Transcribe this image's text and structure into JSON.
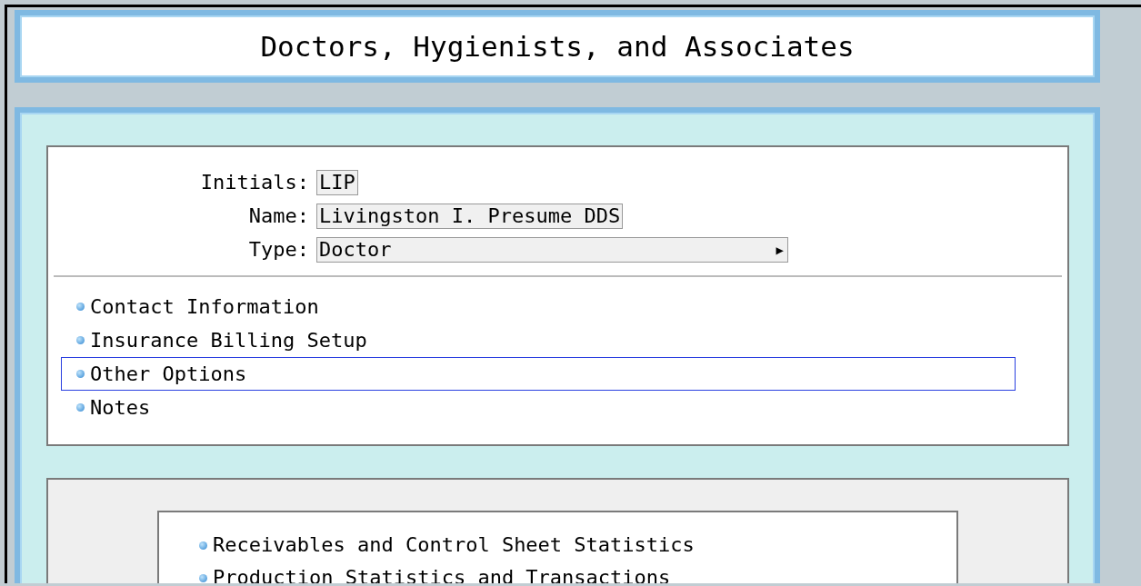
{
  "window": {
    "title": "Doctors, Hygienists, and Associates"
  },
  "fields": [
    {
      "kind": "text",
      "label": "Initials:",
      "value": "LIP"
    },
    {
      "kind": "text",
      "label": "Name:",
      "value": "Livingston I. Presume DDS"
    },
    {
      "kind": "select",
      "label": "Type:",
      "value": "Doctor",
      "arrow": "▶"
    }
  ],
  "options": [
    {
      "label": "Contact Information",
      "selected": false
    },
    {
      "label": "Insurance Billing Setup",
      "selected": false
    },
    {
      "label": "Other Options",
      "selected": true
    },
    {
      "label": "Notes",
      "selected": false
    }
  ],
  "statistics": [
    {
      "label": "Receivables and Control Sheet Statistics"
    },
    {
      "label": "Production Statistics and Transactions"
    }
  ]
}
